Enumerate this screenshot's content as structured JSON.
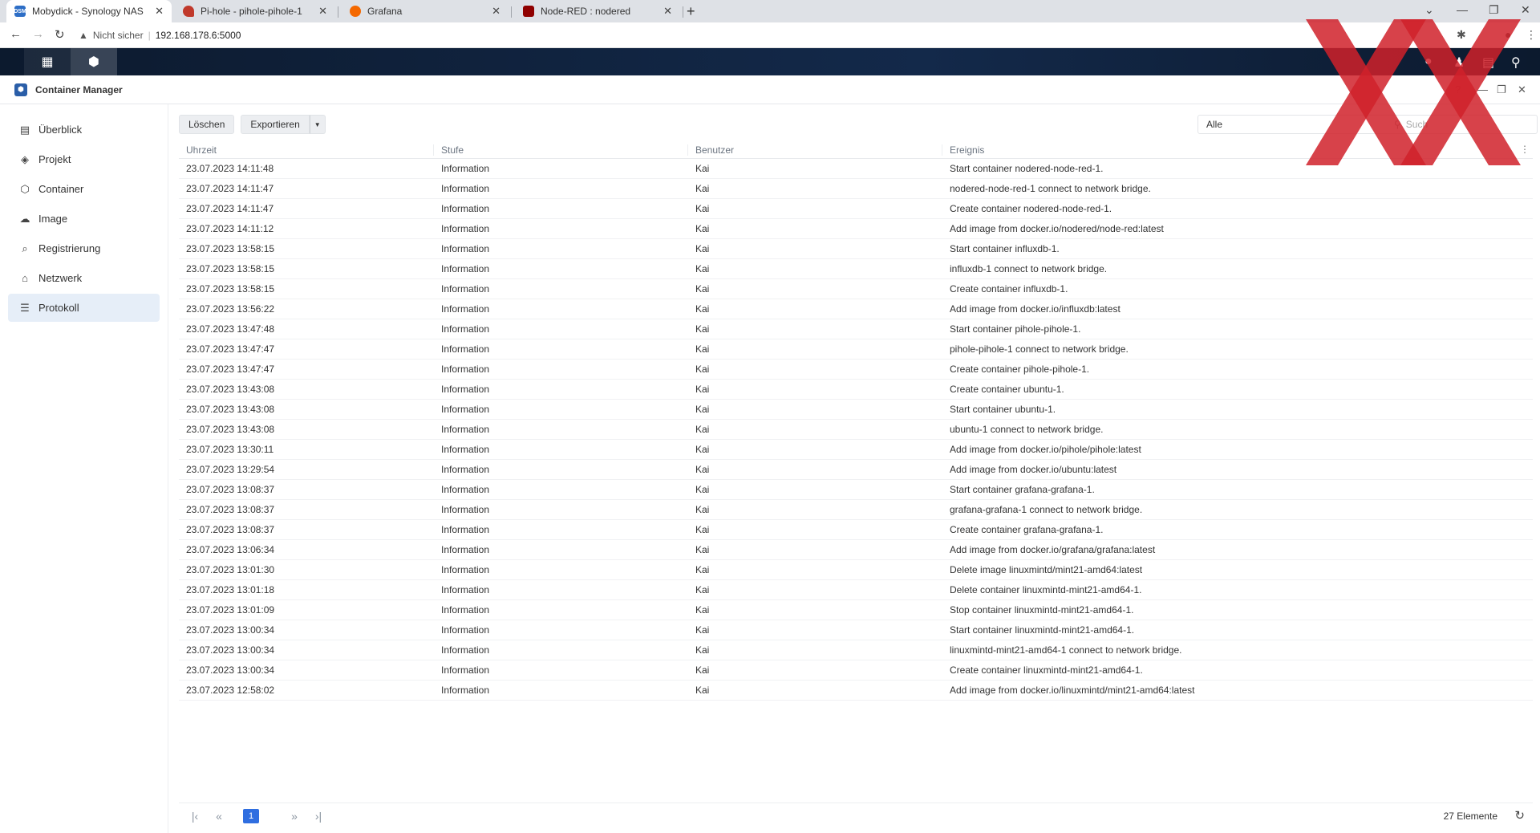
{
  "browser": {
    "tabs": [
      {
        "title": "Mobydick - Synology NAS",
        "active": true,
        "favicon": "dsm-icon",
        "favicon_color": "#2d6ec6"
      },
      {
        "title": "Pi-hole - pihole-pihole-1",
        "active": false,
        "favicon": "pihole-icon",
        "favicon_color": "#c0392b"
      },
      {
        "title": "Grafana",
        "active": false,
        "favicon": "grafana-icon",
        "favicon_color": "#f46800"
      },
      {
        "title": "Node-RED : nodered",
        "active": false,
        "favicon": "nodered-icon",
        "favicon_color": "#8f0000"
      }
    ],
    "security": "Nicht sicher",
    "url": "192.168.178.6:5000"
  },
  "window": {
    "title": "Container Manager"
  },
  "sidebar": {
    "items": [
      {
        "label": "Überblick",
        "icon": "overview-icon",
        "active": false
      },
      {
        "label": "Projekt",
        "icon": "project-icon",
        "active": false
      },
      {
        "label": "Container",
        "icon": "container-icon",
        "active": false
      },
      {
        "label": "Image",
        "icon": "image-cloud-icon",
        "active": false
      },
      {
        "label": "Registrierung",
        "icon": "registry-icon",
        "active": false
      },
      {
        "label": "Netzwerk",
        "icon": "network-icon",
        "active": false
      },
      {
        "label": "Protokoll",
        "icon": "log-list-icon",
        "active": true
      }
    ]
  },
  "toolbar": {
    "delete_label": "Löschen",
    "export_label": "Exportieren"
  },
  "filter": {
    "selected": "Alle",
    "search_placeholder": "Such"
  },
  "table": {
    "columns": [
      "Uhrzeit",
      "Stufe",
      "Benutzer",
      "Ereignis"
    ],
    "rows": [
      [
        "23.07.2023 14:11:48",
        "Information",
        "Kai",
        "Start container nodered-node-red-1."
      ],
      [
        "23.07.2023 14:11:47",
        "Information",
        "Kai",
        "nodered-node-red-1 connect to network bridge."
      ],
      [
        "23.07.2023 14:11:47",
        "Information",
        "Kai",
        "Create container nodered-node-red-1."
      ],
      [
        "23.07.2023 14:11:12",
        "Information",
        "Kai",
        "Add image from docker.io/nodered/node-red:latest"
      ],
      [
        "23.07.2023 13:58:15",
        "Information",
        "Kai",
        "Start container influxdb-1."
      ],
      [
        "23.07.2023 13:58:15",
        "Information",
        "Kai",
        "influxdb-1 connect to network bridge."
      ],
      [
        "23.07.2023 13:58:15",
        "Information",
        "Kai",
        "Create container influxdb-1."
      ],
      [
        "23.07.2023 13:56:22",
        "Information",
        "Kai",
        "Add image from docker.io/influxdb:latest"
      ],
      [
        "23.07.2023 13:47:48",
        "Information",
        "Kai",
        "Start container pihole-pihole-1."
      ],
      [
        "23.07.2023 13:47:47",
        "Information",
        "Kai",
        "pihole-pihole-1 connect to network bridge."
      ],
      [
        "23.07.2023 13:47:47",
        "Information",
        "Kai",
        "Create container pihole-pihole-1."
      ],
      [
        "23.07.2023 13:43:08",
        "Information",
        "Kai",
        "Create container ubuntu-1."
      ],
      [
        "23.07.2023 13:43:08",
        "Information",
        "Kai",
        "Start container ubuntu-1."
      ],
      [
        "23.07.2023 13:43:08",
        "Information",
        "Kai",
        "ubuntu-1 connect to network bridge."
      ],
      [
        "23.07.2023 13:30:11",
        "Information",
        "Kai",
        "Add image from docker.io/pihole/pihole:latest"
      ],
      [
        "23.07.2023 13:29:54",
        "Information",
        "Kai",
        "Add image from docker.io/ubuntu:latest"
      ],
      [
        "23.07.2023 13:08:37",
        "Information",
        "Kai",
        "Start container grafana-grafana-1."
      ],
      [
        "23.07.2023 13:08:37",
        "Information",
        "Kai",
        "grafana-grafana-1 connect to network bridge."
      ],
      [
        "23.07.2023 13:08:37",
        "Information",
        "Kai",
        "Create container grafana-grafana-1."
      ],
      [
        "23.07.2023 13:06:34",
        "Information",
        "Kai",
        "Add image from docker.io/grafana/grafana:latest"
      ],
      [
        "23.07.2023 13:01:30",
        "Information",
        "Kai",
        "Delete image linuxmintd/mint21-amd64:latest"
      ],
      [
        "23.07.2023 13:01:18",
        "Information",
        "Kai",
        "Delete container linuxmintd-mint21-amd64-1."
      ],
      [
        "23.07.2023 13:01:09",
        "Information",
        "Kai",
        "Stop container linuxmintd-mint21-amd64-1."
      ],
      [
        "23.07.2023 13:00:34",
        "Information",
        "Kai",
        "Start container linuxmintd-mint21-amd64-1."
      ],
      [
        "23.07.2023 13:00:34",
        "Information",
        "Kai",
        "linuxmintd-mint21-amd64-1 connect to network bridge."
      ],
      [
        "23.07.2023 13:00:34",
        "Information",
        "Kai",
        "Create container linuxmintd-mint21-amd64-1."
      ],
      [
        "23.07.2023 12:58:02",
        "Information",
        "Kai",
        "Add image from docker.io/linuxmintd/mint21-amd64:latest"
      ]
    ]
  },
  "pager": {
    "current_page": "1",
    "count_label": "27 Elemente"
  },
  "colors": {
    "accent": "#2f6ee0",
    "watermark": "#d0212a"
  }
}
